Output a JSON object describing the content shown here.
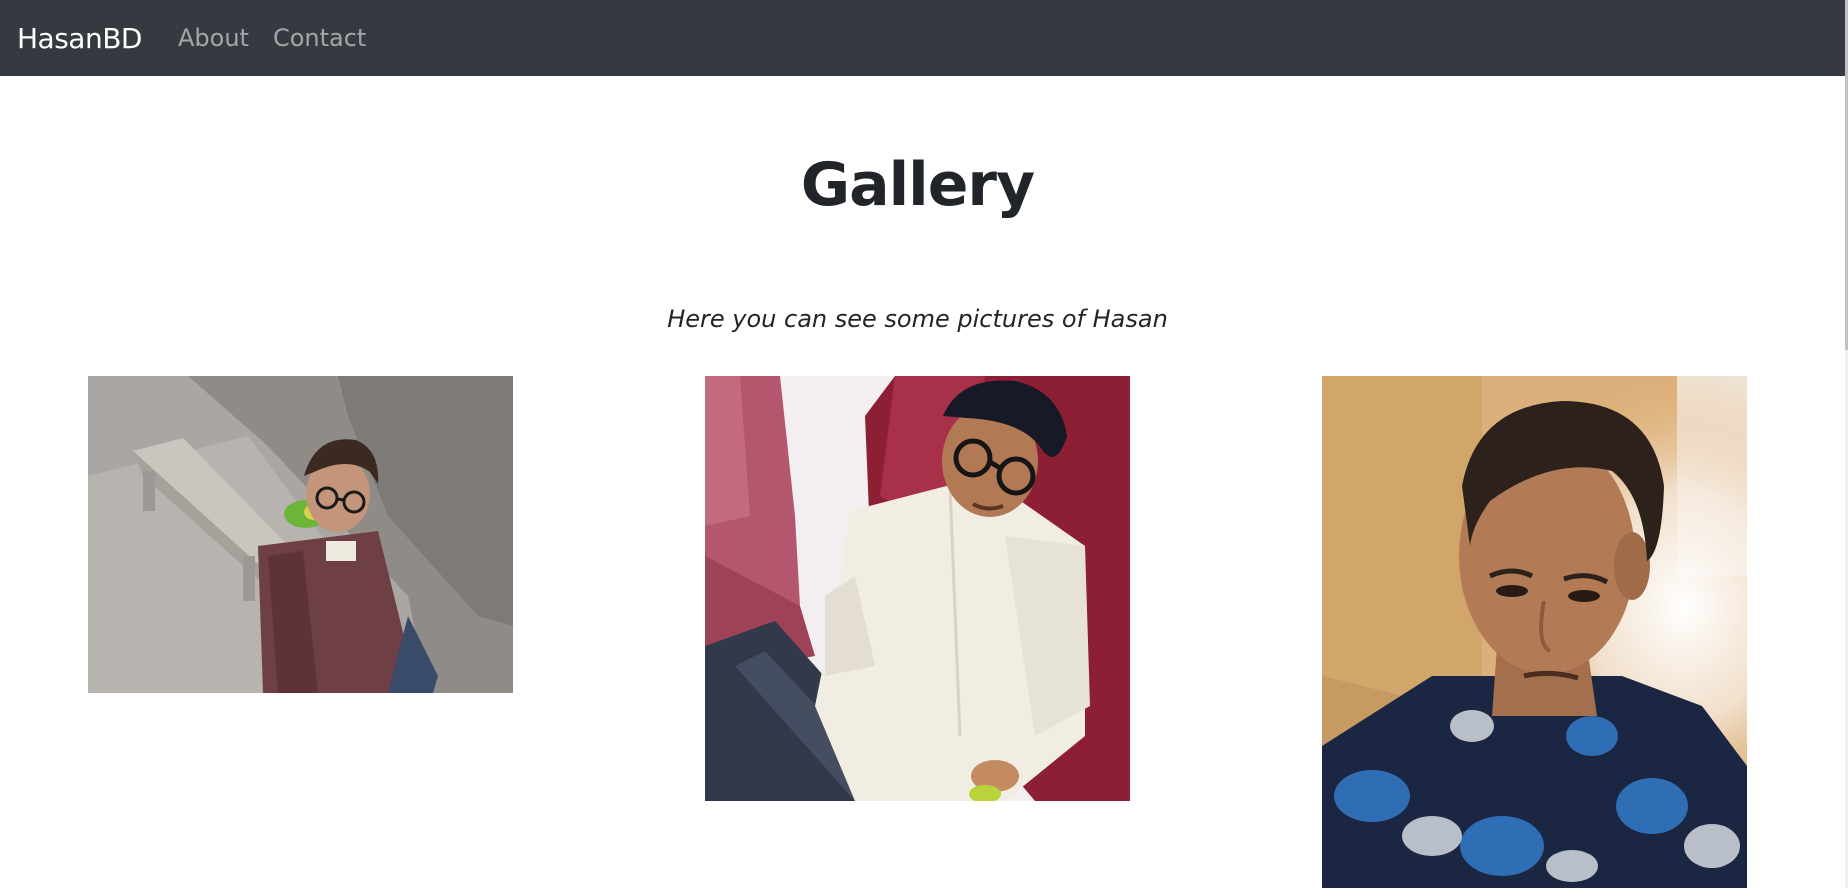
{
  "navbar": {
    "brand": "HasanBD",
    "links": [
      {
        "label": "About"
      },
      {
        "label": "Contact"
      }
    ]
  },
  "gallery": {
    "title": "Gallery",
    "subtitle": "Here you can see some pictures of Hasan",
    "photos": [
      {
        "name": "photo-selfie-concrete-bench"
      },
      {
        "name": "photo-white-kurta-red-sofa"
      },
      {
        "name": "photo-blue-floral-shirt-closeup"
      }
    ]
  },
  "colors": {
    "navbar_bg": "#343a40",
    "brand": "#ffffff",
    "nav_link": "#a0a3a6",
    "text": "#212529"
  }
}
